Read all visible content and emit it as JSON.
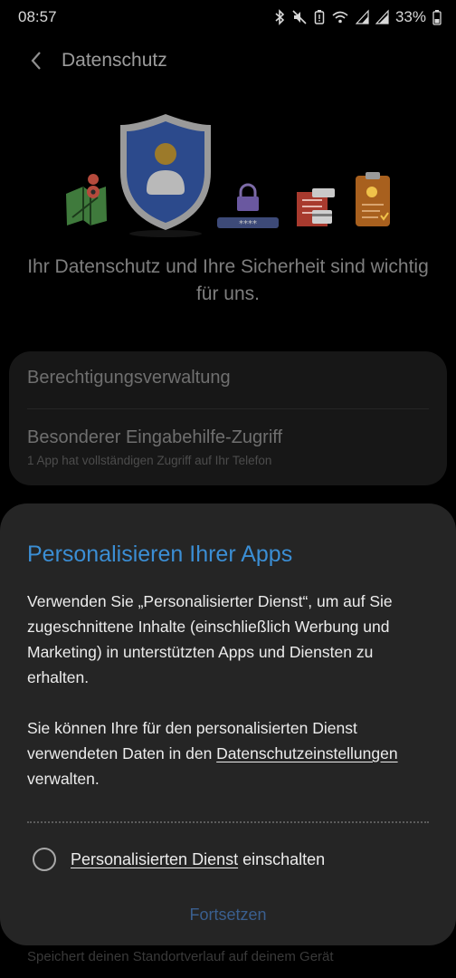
{
  "status": {
    "time": "08:57",
    "battery": "33%"
  },
  "appbar": {
    "title": "Datenschutz"
  },
  "headline": "Ihr Datenschutz und Ihre Sicherheit sind wichtig für uns.",
  "illustration": {
    "pin_code": "****"
  },
  "settings": {
    "items": [
      {
        "label": "Berechtigungsverwaltung"
      },
      {
        "label": "Besonderer Eingabehilfe-Zugriff",
        "sub": "1 App hat vollständigen Zugriff auf Ihr Telefon"
      }
    ],
    "behind_text": "Speichert deinen Standortverlauf auf deinem Gerät"
  },
  "dialog": {
    "title": "Personalisieren Ihrer Apps",
    "para1": "Verwenden Sie „Personalisierter Dienst“, um auf Sie zugeschnittene Inhalte (einschließlich Werbung und Marketing) in unterstützten Apps und Diensten zu erhalten.",
    "para2_pre": "Sie können Ihre für den personalisierten Dienst verwendeten Daten in den ",
    "para2_link": "Datenschutzeinstellungen",
    "para2_post": " verwalten.",
    "toggle_link": "Personalisierten Dienst",
    "toggle_suffix": " einschalten",
    "toggle_checked": false,
    "continue_label": "Fortsetzen"
  },
  "colors": {
    "accent": "#3b8ed4",
    "button_disabled": "#3a5f8f",
    "dialog_bg": "#252525",
    "shield": "#2c4a8c"
  }
}
